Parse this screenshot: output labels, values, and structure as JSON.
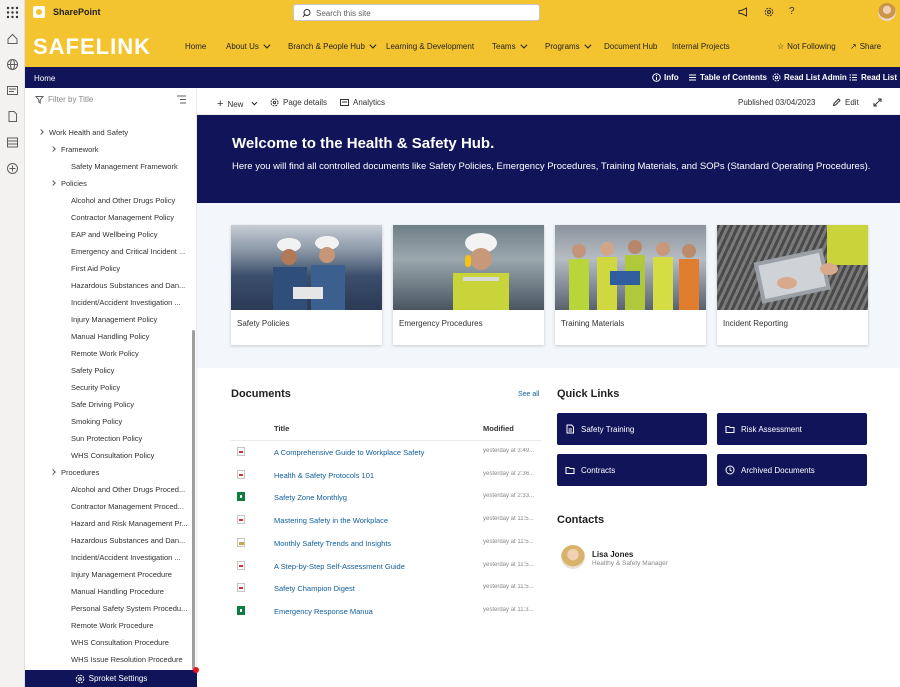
{
  "suite": {
    "app_name": "SharePoint",
    "search_placeholder": "Search this site"
  },
  "hub": {
    "logo": "SAFELINK",
    "nav": [
      {
        "label": "Home",
        "has_menu": false
      },
      {
        "label": "About Us",
        "has_menu": true
      },
      {
        "label": "Branch & People Hub",
        "has_menu": true
      },
      {
        "label": "Learning & Development",
        "has_menu": false
      },
      {
        "label": "Teams",
        "has_menu": true
      },
      {
        "label": "Programs",
        "has_menu": true
      },
      {
        "label": "Document Hub",
        "has_menu": false
      },
      {
        "label": "Internal Projects",
        "has_menu": false
      }
    ],
    "follow_label": "Not Following",
    "share_label": "Share"
  },
  "navbar": {
    "breadcrumb": "Home",
    "info": "Info",
    "toc": "Table of Contents",
    "read_list_admin": "Read List Admin",
    "read_list": "Read List"
  },
  "tree": {
    "filter_placeholder": "Filter by Title",
    "items": [
      {
        "label": "Work Health and Safety",
        "level": 0,
        "chevron": true
      },
      {
        "label": "Framework",
        "level": 1,
        "chevron": true
      },
      {
        "label": "Safety Management Framework",
        "level": 2,
        "chevron": false
      },
      {
        "label": "Policies",
        "level": 1,
        "chevron": true
      },
      {
        "label": "Alcohol and Other Drugs Policy",
        "level": 2,
        "chevron": false
      },
      {
        "label": "Contractor Management Policy",
        "level": 2,
        "chevron": false
      },
      {
        "label": "EAP and Wellbeing Policy",
        "level": 2,
        "chevron": false
      },
      {
        "label": "Emergency and Critical Incident ...",
        "level": 2,
        "chevron": false
      },
      {
        "label": "First Aid Policy",
        "level": 2,
        "chevron": false
      },
      {
        "label": "Hazardous Substances and Dan...",
        "level": 2,
        "chevron": false
      },
      {
        "label": "Incident/Accident Investigation ...",
        "level": 2,
        "chevron": false
      },
      {
        "label": "Injury Management Policy",
        "level": 2,
        "chevron": false
      },
      {
        "label": "Manual Handling Policy",
        "level": 2,
        "chevron": false
      },
      {
        "label": "Remote Work Policy",
        "level": 2,
        "chevron": false
      },
      {
        "label": "Safety Policy",
        "level": 2,
        "chevron": false
      },
      {
        "label": "Security Policy",
        "level": 2,
        "chevron": false
      },
      {
        "label": "Safe Driving Policy",
        "level": 2,
        "chevron": false
      },
      {
        "label": "Smoking Policy",
        "level": 2,
        "chevron": false
      },
      {
        "label": "Sun Protection Policy",
        "level": 2,
        "chevron": false
      },
      {
        "label": "WHS Consultation Policy",
        "level": 2,
        "chevron": false
      },
      {
        "label": "Procedures",
        "level": 1,
        "chevron": true
      },
      {
        "label": "Alcohol and Other Drugs Proced...",
        "level": 2,
        "chevron": false
      },
      {
        "label": "Contractor Management Proced...",
        "level": 2,
        "chevron": false
      },
      {
        "label": "Hazard and Risk Management Pr...",
        "level": 2,
        "chevron": false
      },
      {
        "label": "Hazardous Substances and Dan...",
        "level": 2,
        "chevron": false
      },
      {
        "label": "Incident/Accident Investigation ...",
        "level": 2,
        "chevron": false
      },
      {
        "label": "Injury Management Procedure",
        "level": 2,
        "chevron": false
      },
      {
        "label": "Manual Handling Procedure",
        "level": 2,
        "chevron": false
      },
      {
        "label": "Personal Safety System Procedu...",
        "level": 2,
        "chevron": false
      },
      {
        "label": "Remote Work Procedure",
        "level": 2,
        "chevron": false
      },
      {
        "label": "WHS Consultation Procedure",
        "level": 2,
        "chevron": false
      },
      {
        "label": "WHS Issue Resolution Procedure",
        "level": 2,
        "chevron": false
      }
    ],
    "sprocket_label": "Sproket Settings"
  },
  "command_bar": {
    "new": "New",
    "page_details": "Page details",
    "analytics": "Analytics",
    "published": "Published 03/04/2023",
    "edit": "Edit"
  },
  "hero": {
    "title": "Welcome to the Health & Safety Hub.",
    "subtitle": "Here you will find all controlled documents like Safety Policies, Emergency Procedures, Training Materials, and SOPs (Standard Operating Procedures)."
  },
  "tiles": [
    {
      "label": "Safety Policies"
    },
    {
      "label": "Emergency Procedures"
    },
    {
      "label": "Training Materials"
    },
    {
      "label": "Incident Reporting"
    }
  ],
  "documents": {
    "title": "Documents",
    "see_all": "See all",
    "col_title": "Title",
    "col_modified": "Modified",
    "rows": [
      {
        "name": "A Comprehensive Guide to Workplace Safety",
        "modified": "yesterday at 3:49...",
        "type": "pdf"
      },
      {
        "name": "Health & Safety Protocols 101",
        "modified": "yesterday at 2:36...",
        "type": "pdf"
      },
      {
        "name": "Safety Zone Monthlyg",
        "modified": "yesterday at 2:33...",
        "type": "xlsx"
      },
      {
        "name": "Mastering Safety in the Workplace",
        "modified": "yesterday at 11:5...",
        "type": "pdf"
      },
      {
        "name": "Monthly Safety Trends and Insights",
        "modified": "yesterday at 11:5...",
        "type": "image"
      },
      {
        "name": "A Step-by-Step Self-Assessment Guide",
        "modified": "yesterday at 11:5...",
        "type": "pdf"
      },
      {
        "name": "Safety Champion Digest",
        "modified": "yesterday at 11:5...",
        "type": "pdf"
      },
      {
        "name": "Emergency Response Manua",
        "modified": "yesterday at 11:3...",
        "type": "xlsx"
      }
    ]
  },
  "quick_links": {
    "title": "Quick Links",
    "items": [
      {
        "label": "Safety Training"
      },
      {
        "label": "Risk Assessment"
      },
      {
        "label": "Contracts"
      },
      {
        "label": "Archived Documents"
      }
    ]
  },
  "contacts": {
    "title": "Contacts",
    "name": "Lisa Jones",
    "role": "Healthy & Safety Manager"
  },
  "colors": {
    "brand_yellow": "#f4c430",
    "navy": "#12145a",
    "link_blue": "#0f5e9c"
  }
}
